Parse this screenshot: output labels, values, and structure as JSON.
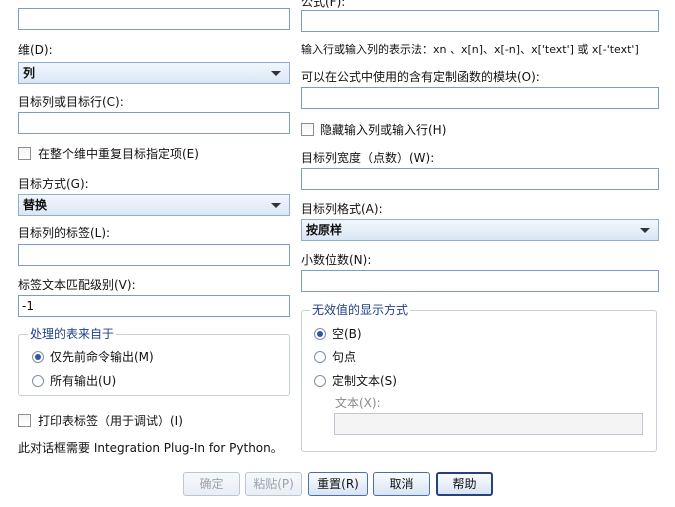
{
  "left": {
    "dimension_label": "维(D):",
    "dimension_value": "列",
    "target_col_row_label": "目标列或目标行(C):",
    "target_col_row_value": "",
    "repeat_target_label": "在整个维中重复目标指定项(E)",
    "target_method_label": "目标方式(G):",
    "target_method_value": "替换",
    "target_col_label_label": "目标列的标签(L):",
    "target_col_label_value": "",
    "label_match_level_label": "标签文本匹配级别(V):",
    "label_match_level_value": "-1",
    "process_group_title": "处理的表来自于",
    "radio_last_command": "仅先前命令输出(M)",
    "radio_all_output": "所有输出(U)",
    "print_labels_label": "打印表标签（用于调试）(I)",
    "python_note": "此对话框需要 Integration Plug-In for Python。"
  },
  "right": {
    "formula_label": "公式(F):",
    "formula_value": "",
    "expression_note": "输入行或输入列的表示法：xn 、x[n]、x[-n]、x['text'] 或 x[-'text']",
    "module_label": "可以在公式中使用的含有定制函数的模块(O):",
    "module_value": "",
    "hide_input_label": "隐藏输入列或输入行(H)",
    "width_label": "目标列宽度（点数）(W):",
    "width_value": "",
    "format_label": "目标列格式(A):",
    "format_value": "按原样",
    "decimals_label": "小数位数(N):",
    "decimals_value": "",
    "invalid_group_title": "无效值的显示方式",
    "radio_empty": "空(B)",
    "radio_period": "句点",
    "radio_custom": "定制文本(S)",
    "text_label": "文本(X):",
    "text_value": ""
  },
  "buttons": {
    "ok": "确定",
    "paste": "粘贴(P)",
    "reset": "重置(R)",
    "cancel": "取消",
    "help": "帮助"
  }
}
